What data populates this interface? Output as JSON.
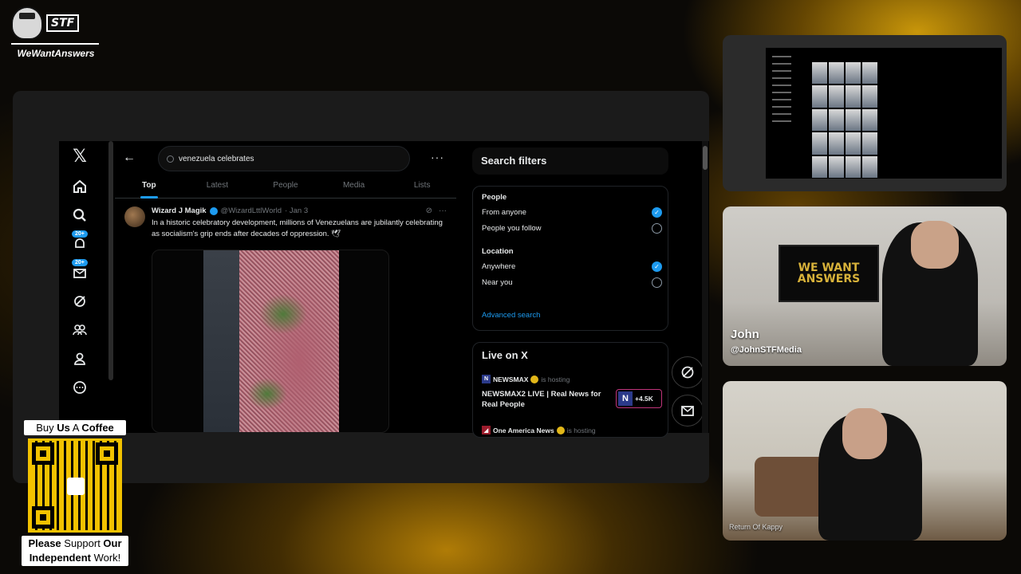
{
  "brand": {
    "name": "WeWantAnswers",
    "logo_text": "STF"
  },
  "x": {
    "logo": "𝕏",
    "nav": [
      {
        "name": "home-icon",
        "glyph": "⌂"
      },
      {
        "name": "search-icon",
        "glyph": "⚲"
      },
      {
        "name": "notifications-icon",
        "glyph": "🔔",
        "badge": "20+"
      },
      {
        "name": "messages-icon",
        "glyph": "✉",
        "badge": "20+"
      },
      {
        "name": "grok-icon",
        "glyph": "⊘"
      },
      {
        "name": "communities-icon",
        "glyph": "⚇"
      },
      {
        "name": "profile-icon",
        "glyph": "♙"
      },
      {
        "name": "more-icon",
        "glyph": "⋯"
      }
    ],
    "search": {
      "value": "venezuela celebrates",
      "back": "←",
      "more": "···"
    },
    "tabs": [
      "Top",
      "Latest",
      "People",
      "Media",
      "Lists"
    ],
    "active_tab": "Top",
    "tweet": {
      "name": "Wizard J Magik",
      "handle": "@WizardLttlWorld",
      "date": "· Jan 3",
      "text": "In a historic celebratory development, millions of Venezuelans are jubilantly celebrating as socialism's grip ends after decades of oppression. 🕊"
    },
    "filters": {
      "title": "Search filters",
      "people_label": "People",
      "people_options": [
        {
          "label": "From anyone",
          "checked": true
        },
        {
          "label": "People you follow",
          "checked": false
        }
      ],
      "location_label": "Location",
      "location_options": [
        {
          "label": "Anywhere",
          "checked": true
        },
        {
          "label": "Near you",
          "checked": false
        }
      ],
      "advanced": "Advanced search"
    },
    "live": {
      "title": "Live on X",
      "host1": "NEWSMAX",
      "hosting": "is hosting",
      "stream_title": "NEWSMAX2 LIVE | Real News for Real People",
      "count": "+4.5K",
      "host2": "One America News"
    }
  },
  "cams": {
    "john_name": "John",
    "john_handle": "@JohnSTFMedia",
    "poster": "WE WANT ANSWERS",
    "kappy": "Return Of Kappy"
  },
  "coffee": {
    "line1_a": "Buy ",
    "line1_b": "Us",
    "line1_c": " A ",
    "line1_d": "Coffee",
    "line2_a": "Please",
    "line2_b": " Support ",
    "line2_c": "Our",
    "line3_a": "Independent",
    "line3_b": " Work!"
  },
  "colors": {
    "accent": "#1d9bf0",
    "background": "#000000",
    "gold": "#c8960a"
  }
}
